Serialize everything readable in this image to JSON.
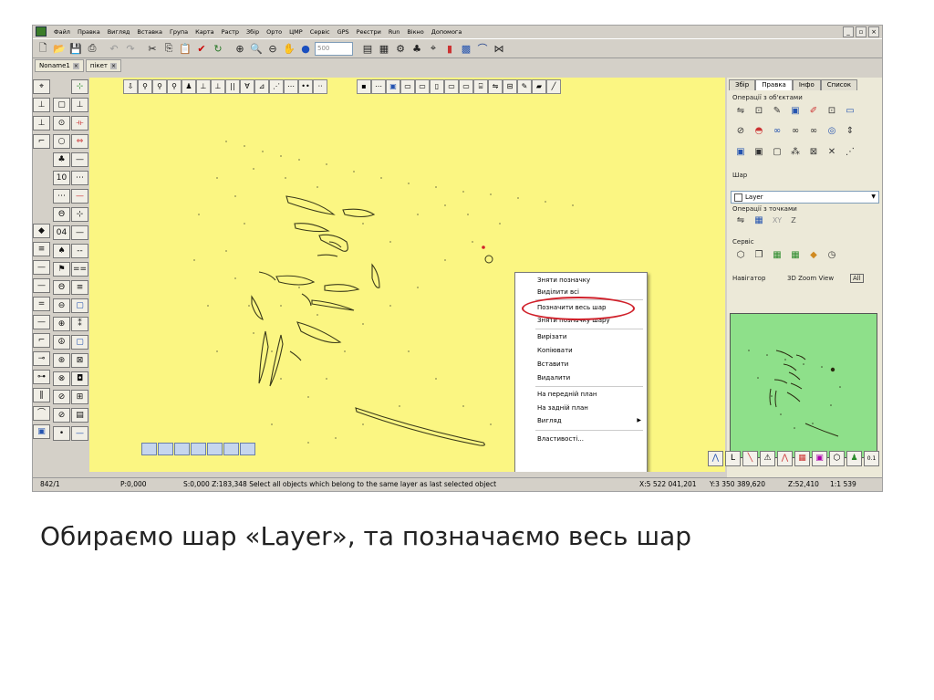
{
  "menu": [
    "Файл",
    "Правка",
    "Вигляд",
    "Вставка",
    "Група",
    "Карта",
    "Растр",
    "Збір",
    "Орто",
    "ЦМР",
    "Сервіс",
    "GPS",
    "Реєстри",
    "Run",
    "Вікно",
    "Допомога"
  ],
  "toolbar": {
    "zoom_value": "500"
  },
  "doc_tabs": [
    "Noname1",
    "пікет"
  ],
  "context_menu": {
    "items": [
      "Зняти позначку",
      "Виділити всі",
      "Позначити весь шар",
      "Зняти позначку шару",
      "Вирізати",
      "Копіювати",
      "Вставити",
      "Видалити",
      "На передній план",
      "На задній план",
      "Вигляд",
      "Властивості..."
    ],
    "highlighted": "Позначити весь шар",
    "ring_color": "#d0202a"
  },
  "right_panel": {
    "tabs": [
      "Збір",
      "Правка",
      "Інфо",
      "Список"
    ],
    "active_tab": "Правка",
    "section_objects": "Операції з об'єктами",
    "section_layer": "Шар",
    "layer_value": "Layer",
    "section_points": "Операції з точками",
    "xy_label": "XY",
    "z_label": "Z",
    "section_service": "Сервіс",
    "navigator_label": "Навігатор",
    "zoom_label": "3D Zoom View",
    "all_label": "All"
  },
  "status": {
    "left": "842/1",
    "p": "P:0,000",
    "message": "S:0,000 Z:183,348  Select all objects which belong to the same layer as last selected object",
    "x": "X:5 522 041,201",
    "y": "Y:3 350 389,620",
    "z": "Z:52,410",
    "scale": "1:1 539"
  },
  "caption": "Обираємо шар «Layer», та позначаємо весь шар",
  "colors": {
    "canvas": "#fbf682",
    "navigator": "#8ee08a",
    "highlight_ring": "#d0202a"
  }
}
